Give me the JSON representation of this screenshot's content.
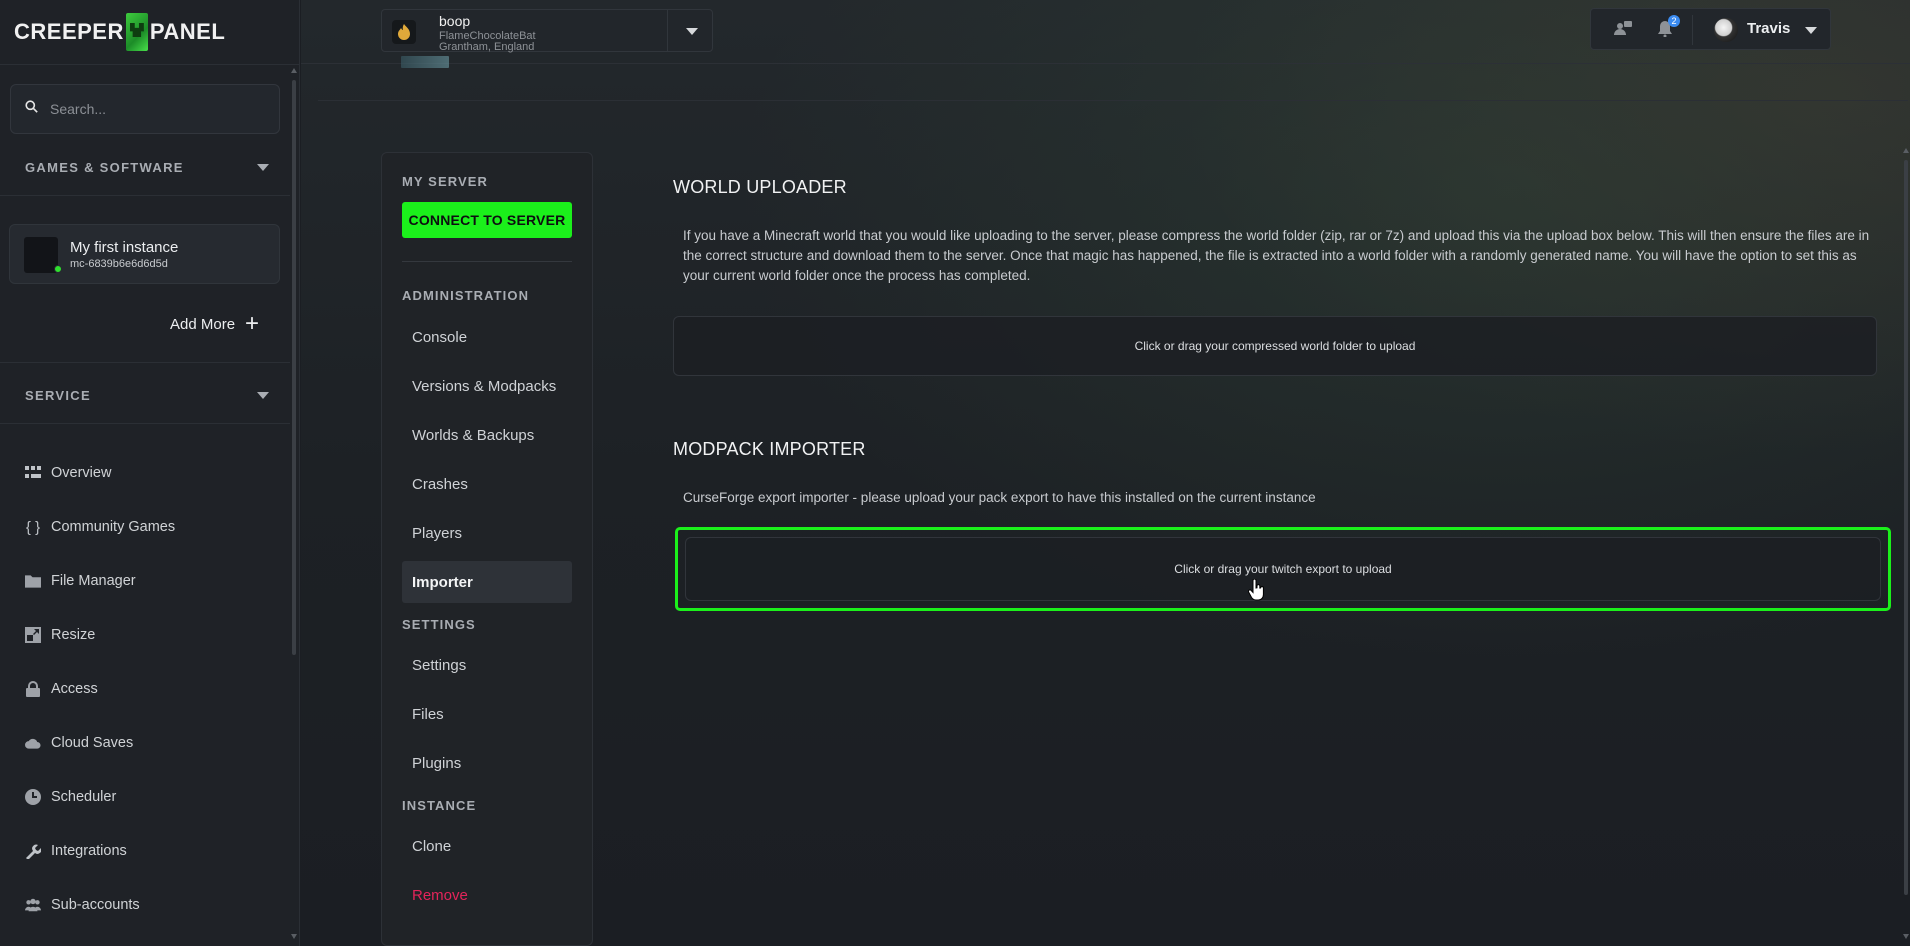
{
  "brand": {
    "left": "CREEPER",
    "right": "PANEL"
  },
  "sidebar": {
    "search_placeholder": "Search...",
    "games_heading": "GAMES & SOFTWARE",
    "instance": {
      "name": "My first instance",
      "id": "mc-6839b6e6d6d5d",
      "status_color": "#2fe12f"
    },
    "add_more": "Add More",
    "service_heading": "SERVICE",
    "nav": [
      {
        "label": "Overview",
        "icon": "grid-icon"
      },
      {
        "label": "Community Games",
        "icon": "braces-icon"
      },
      {
        "label": "File Manager",
        "icon": "folder-icon"
      },
      {
        "label": "Resize",
        "icon": "resize-icon"
      },
      {
        "label": "Access",
        "icon": "lock-icon"
      },
      {
        "label": "Cloud Saves",
        "icon": "cloud-icon"
      },
      {
        "label": "Scheduler",
        "icon": "clock-icon"
      },
      {
        "label": "Integrations",
        "icon": "wrench-icon"
      },
      {
        "label": "Sub-accounts",
        "icon": "users-icon"
      }
    ]
  },
  "topbar": {
    "server": {
      "name": "boop",
      "owner": "FlameChocolateBat",
      "location": "Grantham, England"
    },
    "notifications_count": "2",
    "user": {
      "name": "Travis"
    }
  },
  "server_menu": {
    "my_server_heading": "MY SERVER",
    "connect_button": "CONNECT TO SERVER",
    "administration_heading": "ADMINISTRATION",
    "administration_items": [
      "Console",
      "Versions & Modpacks",
      "Worlds & Backups",
      "Crashes",
      "Players",
      "Importer"
    ],
    "active_item": "Importer",
    "settings_heading": "SETTINGS",
    "settings_items": [
      "Settings",
      "Files",
      "Plugins"
    ],
    "instance_heading": "INSTANCE",
    "instance_items": [
      "Clone",
      "Remove"
    ]
  },
  "world_uploader": {
    "title": "WORLD UPLOADER",
    "description": "If you have a Minecraft world that you would like uploading to the server, please compress the world folder (zip, rar or 7z) and upload this via the upload box below. This will then ensure the files are in the correct structure and download them to the server. Once that magic has happened, the file is extracted into a world folder with a randomly generated name. You will have the option to set this as your current world folder once the process has completed.",
    "dropzone": "Click or drag your compressed world folder to upload"
  },
  "modpack_importer": {
    "title": "MODPACK IMPORTER",
    "description": "CurseForge export importer - please upload your pack export to have this installed on the current instance",
    "dropzone": "Click or drag your twitch export to upload"
  },
  "colors": {
    "accent_green": "#1bf01b",
    "danger": "#e3245a",
    "badge_blue": "#3b8bf0"
  }
}
